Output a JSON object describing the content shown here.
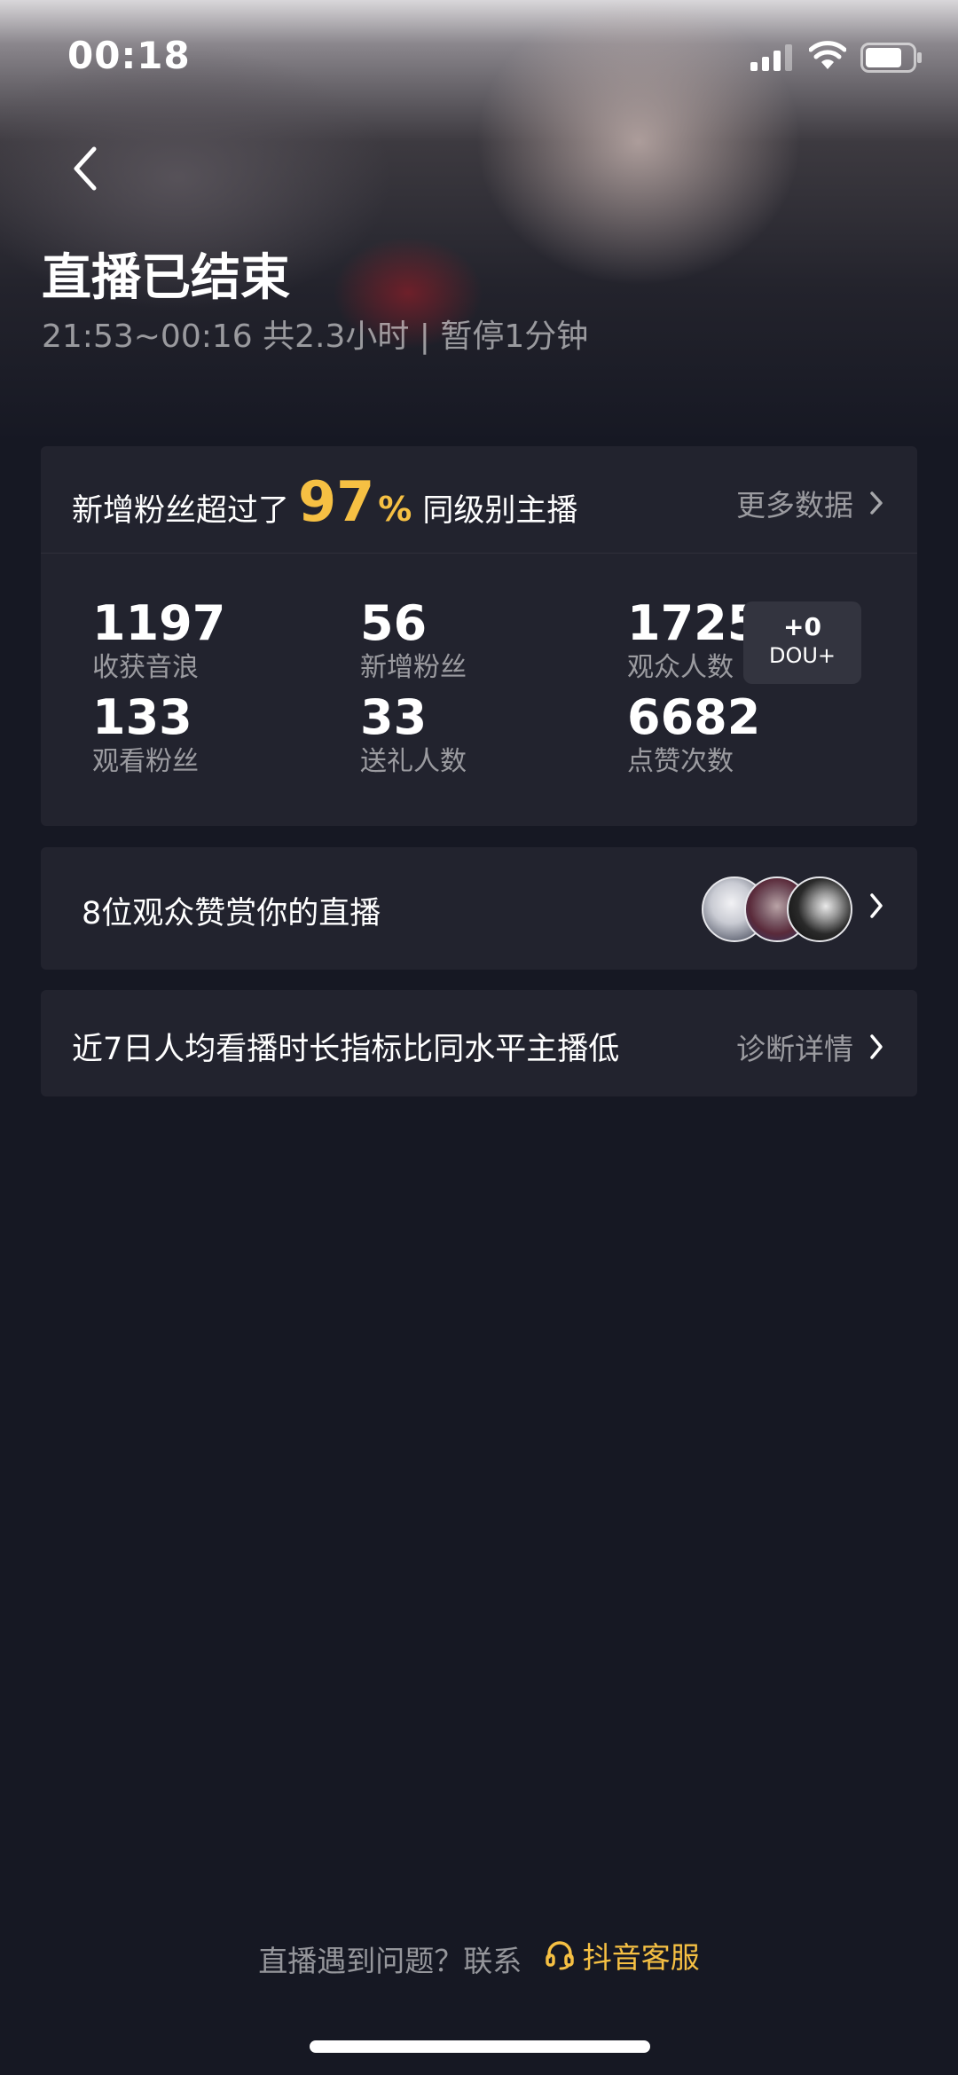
{
  "status_bar": {
    "time": "00:18"
  },
  "header": {
    "title": "直播已结束",
    "subtitle": "21:53~00:16 共2.3小时 | 暂停1分钟"
  },
  "rank": {
    "prefix": "新增粉丝超过了",
    "percent": "97",
    "percent_sign": "%",
    "suffix": "同级别主播",
    "more_label": "更多数据"
  },
  "stats": [
    {
      "value": "1197",
      "label": "收获音浪"
    },
    {
      "value": "56",
      "label": "新增粉丝"
    },
    {
      "value": "1725",
      "label": "观众人数"
    },
    {
      "value": "133",
      "label": "观看粉丝"
    },
    {
      "value": "33",
      "label": "送礼人数"
    },
    {
      "value": "6682",
      "label": "点赞次数"
    }
  ],
  "dou_badge": {
    "value": "+0",
    "label": "DOU+"
  },
  "reward": {
    "text": "8位观众赞赏你的直播"
  },
  "diagnosis": {
    "text": "近7日人均看播时长指标比同水平主播低",
    "link": "诊断详情"
  },
  "footer": {
    "prompt": "直播遇到问题？联系",
    "service": "抖音客服"
  },
  "colors": {
    "background": "#161823",
    "card": "#22232e",
    "accent": "#f6c043"
  }
}
